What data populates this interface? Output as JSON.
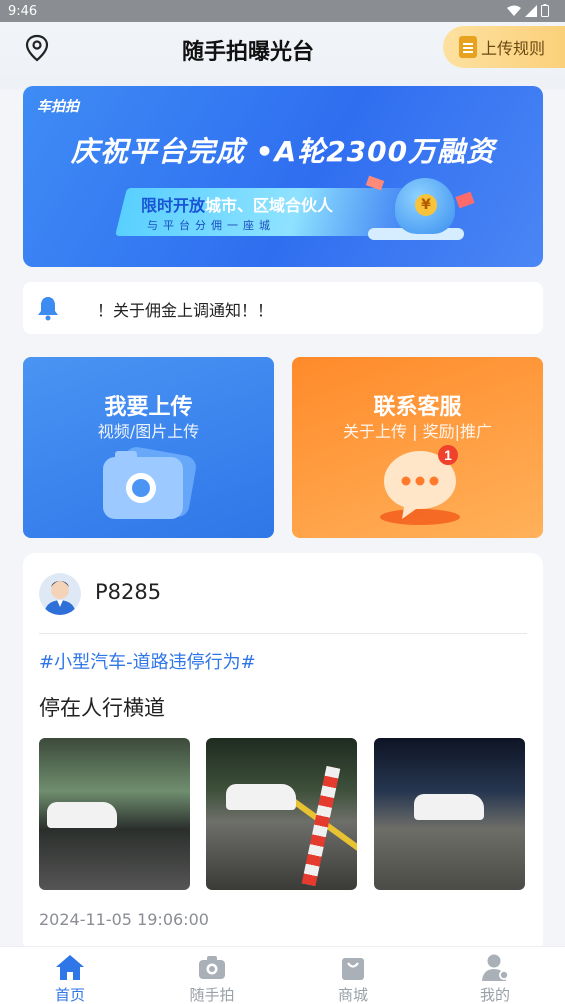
{
  "status_bar": {
    "time": "9:46"
  },
  "header": {
    "title": "随手拍曝光台",
    "rules_button": "上传规则"
  },
  "banner": {
    "brand": "车拍拍",
    "headline": "庆祝平台完成 •A轮2300万融资",
    "strip_highlight": "限时开放",
    "strip_rest": "城市、区域合伙人",
    "strip_sub": "与平台分佣一座城"
  },
  "notice": {
    "text": "！关于佣金上调通知！！"
  },
  "actions": {
    "upload": {
      "title": "我要上传",
      "subtitle": "视频/图片上传"
    },
    "service": {
      "title": "联系客服",
      "subtitle": "关于上传 | 奖励|推广",
      "badge": "1"
    }
  },
  "post": {
    "username": "P8285",
    "tag": "#小型汽车-道路违停行为#",
    "description": "停在人行横道",
    "timestamp": "2024-11-05 19:06:00"
  },
  "tabs": [
    {
      "label": "首页",
      "icon": "home-icon",
      "active": true
    },
    {
      "label": "随手拍",
      "icon": "camera-icon",
      "active": false
    },
    {
      "label": "商城",
      "icon": "shopping-bag-icon",
      "active": false
    },
    {
      "label": "我的",
      "icon": "user-icon",
      "active": false
    }
  ],
  "colors": {
    "accent": "#2f76e8",
    "upload_card": "#3a84ee",
    "service_card": "#ff9a3a",
    "rules_button": "#fbd07a"
  }
}
